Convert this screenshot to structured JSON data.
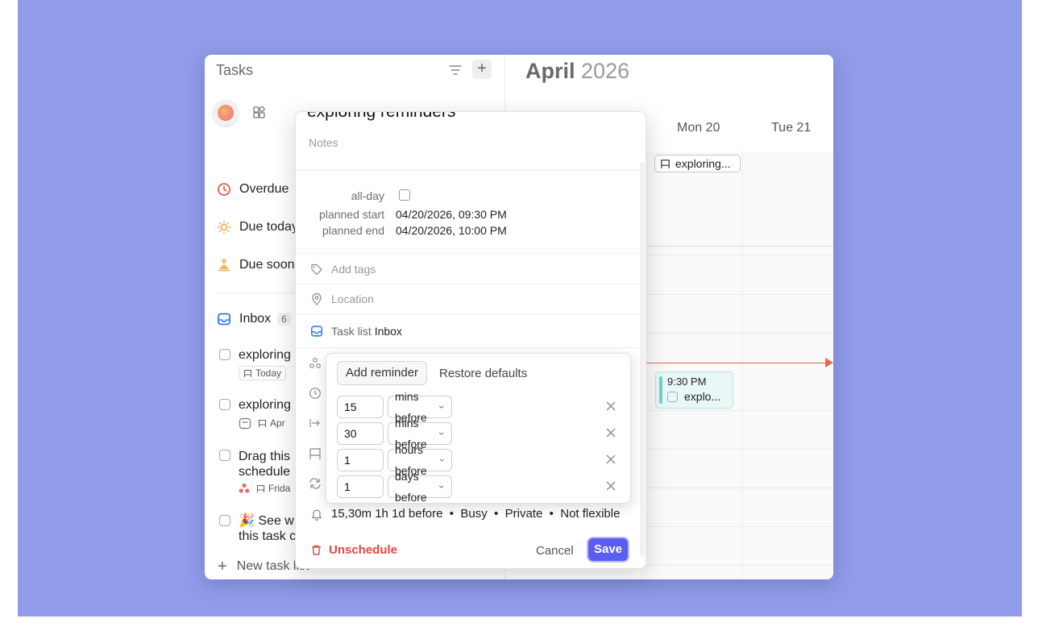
{
  "sidebar": {
    "title": "Tasks",
    "items": [
      {
        "label": "Overdue",
        "icon": "clock-icon"
      },
      {
        "label": "Due today",
        "icon": "sun-icon"
      },
      {
        "label": "Due soon",
        "icon": "sunrise-icon"
      }
    ],
    "inbox": {
      "label": "Inbox",
      "count": "6"
    },
    "tasks": [
      {
        "title": "exploring",
        "chip": "Today"
      },
      {
        "title": "exploring",
        "chip": "Apr"
      },
      {
        "title_line1": "Drag this",
        "title_line2": "schedule",
        "chip": "Frida"
      },
      {
        "title_line1": "🎉 See w",
        "title_line2": "this task c"
      }
    ],
    "new_list": "New task list"
  },
  "calendar": {
    "month": "April",
    "year": "2026",
    "days": [
      "Mon 20",
      "Tue 21"
    ],
    "allday_event": "exploring...",
    "event": {
      "time": "9:30 PM",
      "title": "explo..."
    },
    "now_color": "#e8674f"
  },
  "popover": {
    "title": "exploring reminders",
    "notes_placeholder": "Notes",
    "allday_label": "all-day",
    "planned_start_label": "planned start",
    "planned_start": "04/20/2026, 09:30 PM",
    "planned_end_label": "planned end",
    "planned_end": "04/20/2026, 10:00 PM",
    "tags_placeholder": "Add tags",
    "location_placeholder": "Location",
    "task_list_label": "Task list",
    "task_list_value": "Inbox",
    "summary": "15,30m 1h 1d before  •  Busy  •  Private  •  Not flexible",
    "unschedule": "Unschedule",
    "cancel": "Cancel",
    "save": "Save",
    "accent": "#5b5cf0"
  },
  "reminders": {
    "add_label": "Add reminder",
    "restore_label": "Restore defaults",
    "rows": [
      {
        "value": "15",
        "unit": "mins before"
      },
      {
        "value": "30",
        "unit": "mins before"
      },
      {
        "value": "1",
        "unit": "hours before"
      },
      {
        "value": "1",
        "unit": "days before"
      }
    ]
  }
}
